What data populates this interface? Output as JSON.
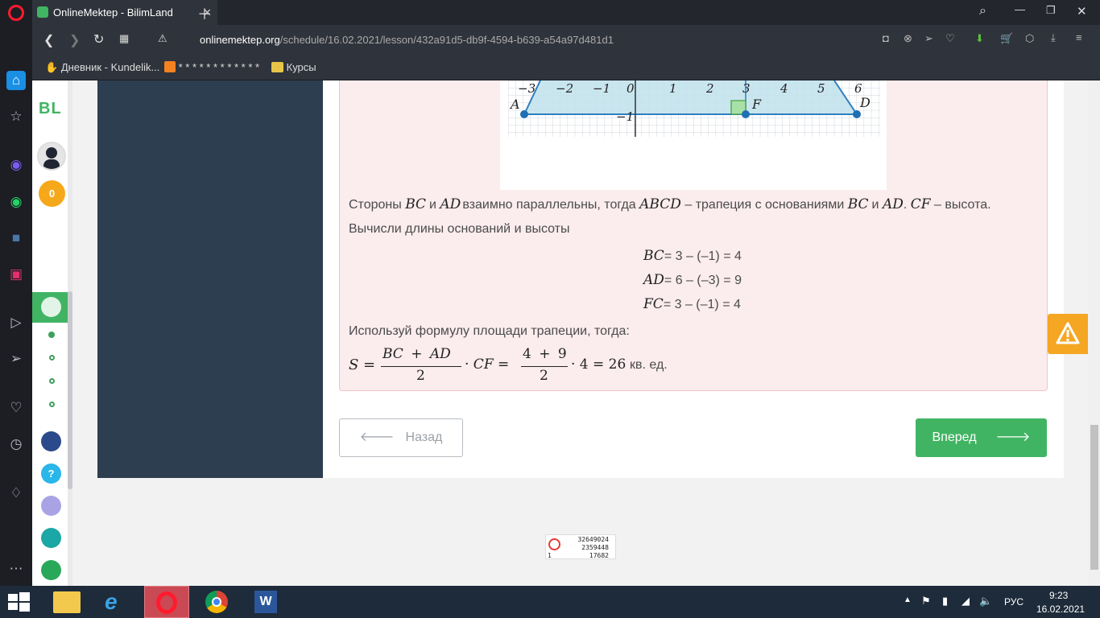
{
  "browser": {
    "tab_title": "OnlineMektep - BilimLand",
    "url_domain": "onlinemektep.org",
    "url_path": "/schedule/16.02.2021/lesson/432a91d5-db9f-4594-b639-a54a97d481d1",
    "bookmarks": [
      "Дневник - Kundelik...",
      "* * * * * * * * * * * *",
      "Курсы"
    ]
  },
  "site_sidebar": {
    "brand": "BL",
    "coins": "0"
  },
  "graph": {
    "x_ticks": [
      "−3",
      "−2",
      "−1",
      "0",
      "1",
      "2",
      "3",
      "4",
      "5",
      "6"
    ],
    "y_tick": "−1",
    "points": [
      "A",
      "F",
      "D"
    ]
  },
  "solution": {
    "line1": {
      "p1": "Стороны",
      "v1": "BC",
      "p2": "и",
      "v2": "AD",
      "p3": "взаимно параллельны, тогда",
      "v3": "ABCD",
      "p4": "– трапеция с основаниями",
      "v4": "BC",
      "p5": "и",
      "v5": "AD",
      "p6": ".",
      "v6": "CF",
      "p7": "– высота."
    },
    "line2": "Вычисли длины оснований и высоты",
    "eqs": [
      {
        "var": "BC",
        "expr": "= 3 – (–1) = 4"
      },
      {
        "var": "AD",
        "expr": "= 6 – (–3) = 9"
      },
      {
        "var": "FC",
        "expr": "= 3 – (–1) = 4"
      }
    ],
    "line3": "Используй формулу площади трапеции, тогда:",
    "formula": {
      "s": "S =",
      "num1": "BC + AD",
      "den1": "2",
      "mid": "· CF =",
      "num2": "4 + 9",
      "den2": "2",
      "end": "· 4 = 26",
      "unit": "кв. ед."
    }
  },
  "nav": {
    "back": "Назад",
    "next": "Вперед"
  },
  "counter": [
    "32649024",
    "2359448",
    "17682",
    "1"
  ],
  "taskbar": {
    "lang": "РУС",
    "time": "9:23",
    "date": "16.02.2021"
  }
}
